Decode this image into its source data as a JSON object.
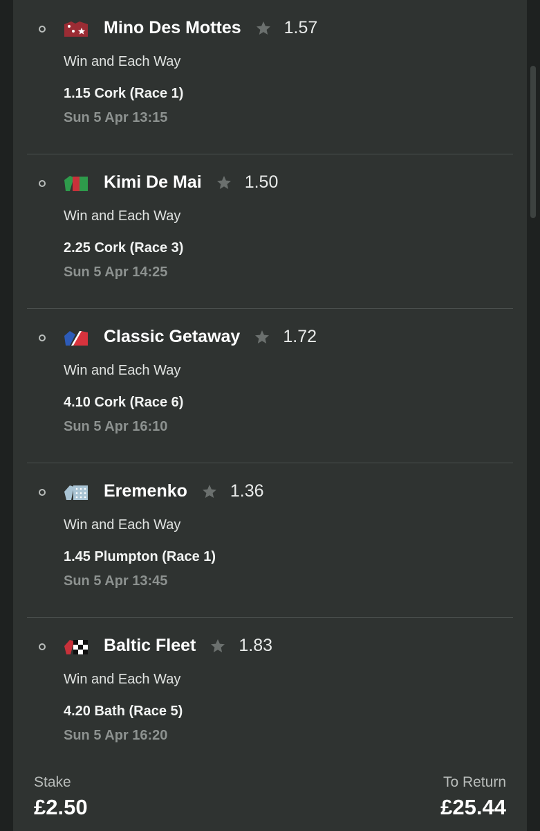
{
  "selections": [
    {
      "name": "Mino Des Mottes",
      "odds": "1.57",
      "market": "Win and Each Way",
      "race": "1.15 Cork (Race 1)",
      "time": "Sun 5 Apr 13:15",
      "silk": "silk-maroon-stars-icon"
    },
    {
      "name": "Kimi De Mai",
      "odds": "1.50",
      "market": "Win and Each Way",
      "race": "2.25 Cork (Race 3)",
      "time": "Sun 5 Apr 14:25",
      "silk": "silk-green-red-icon"
    },
    {
      "name": "Classic Getaway",
      "odds": "1.72",
      "market": "Win and Each Way",
      "race": "4.10 Cork (Race 6)",
      "time": "Sun 5 Apr 16:10",
      "silk": "silk-red-white-blue-icon"
    },
    {
      "name": "Eremenko",
      "odds": "1.36",
      "market": "Win and Each Way",
      "race": "1.45 Plumpton (Race 1)",
      "time": "Sun 5 Apr 13:45",
      "silk": "silk-lightblue-spots-icon"
    },
    {
      "name": "Baltic Fleet",
      "odds": "1.83",
      "market": "Win and Each Way",
      "race": "4.20 Bath (Race 5)",
      "time": "Sun 5 Apr 16:20",
      "silk": "silk-red-black-white-check-icon"
    }
  ],
  "footer": {
    "stake_label": "Stake",
    "stake_value": "£2.50",
    "return_label": "To Return",
    "return_value": "£25.44"
  },
  "colors": {
    "background": "#1e2120",
    "panel": "#2f3331",
    "divider": "#4a4f4d",
    "star": "#6b706e"
  }
}
